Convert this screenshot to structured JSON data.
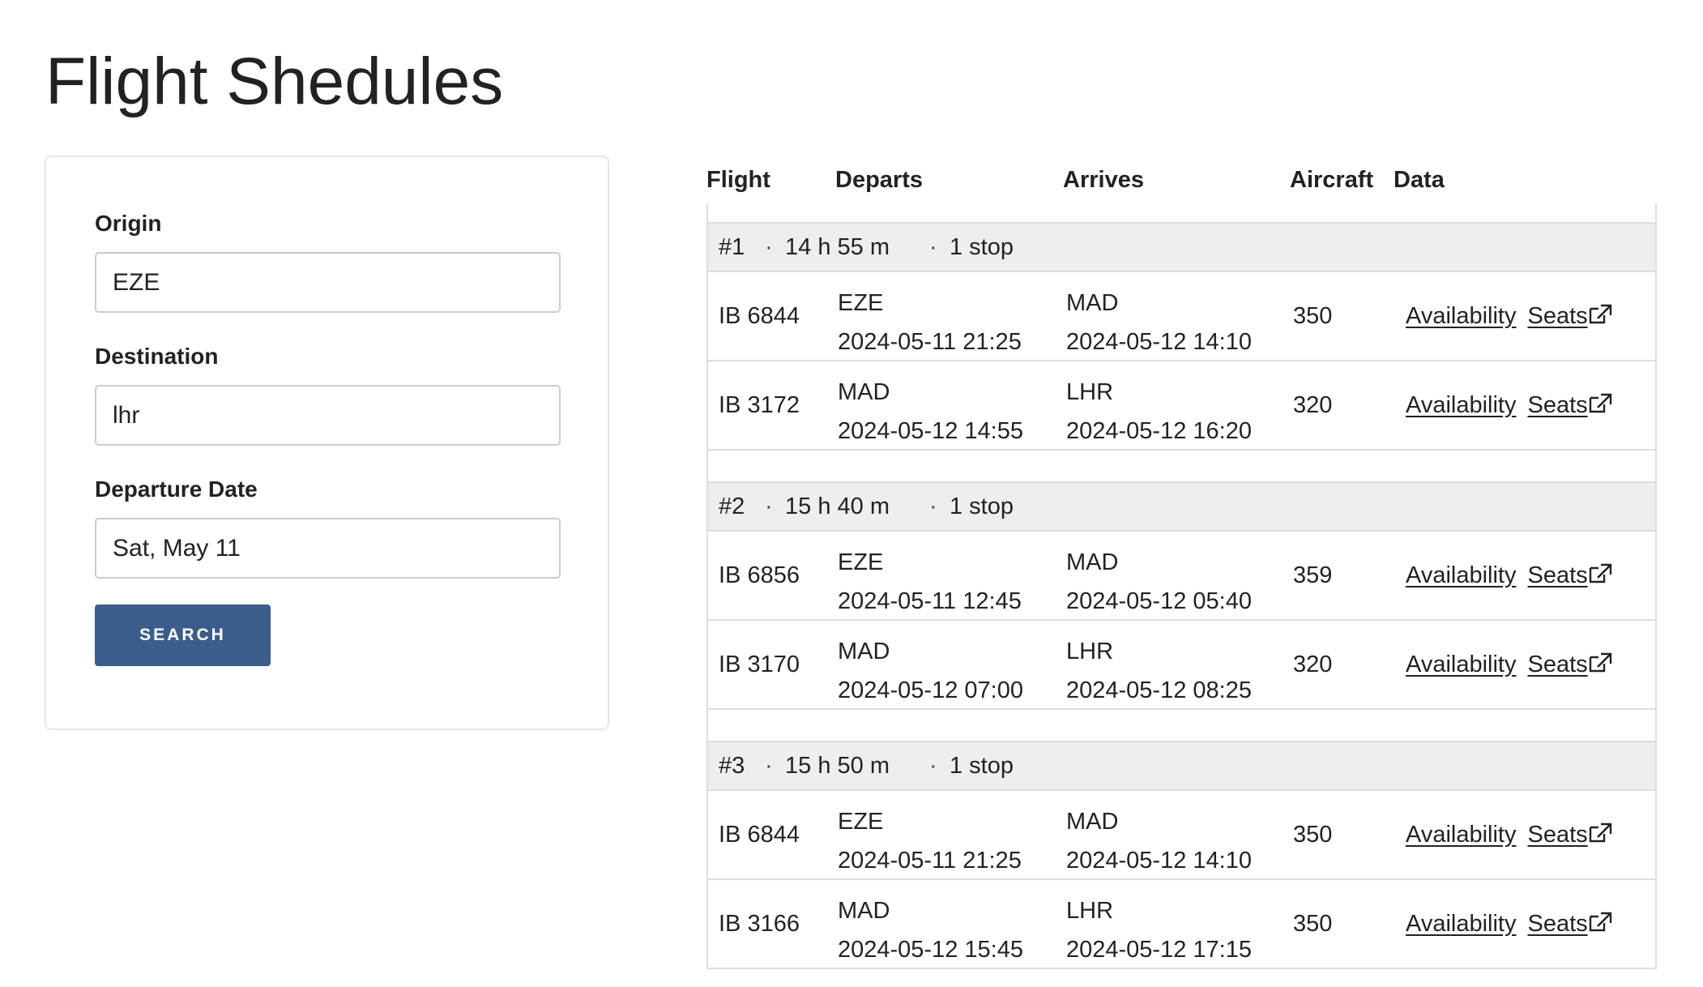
{
  "page_title": "Flight Shedules",
  "search": {
    "origin_label": "Origin",
    "origin_value": "EZE",
    "destination_label": "Destination",
    "destination_value": "lhr",
    "date_label": "Departure Date",
    "date_value": "Sat, May 11",
    "button_label": "SEARCH",
    "button_color": "#3a5d8c"
  },
  "table": {
    "headers": {
      "flight": "Flight",
      "departs": "Departs",
      "arrives": "Arrives",
      "aircraft": "Aircraft",
      "data": "Data"
    },
    "link_labels": {
      "availability": "Availability",
      "seats": "Seats"
    },
    "groups": [
      {
        "num": "#1",
        "duration": "14 h 55 m",
        "stops": "1 stop",
        "flights": [
          {
            "flight": "IB 6844",
            "dep_airport": "EZE",
            "dep_time": "2024-05-11 21:25",
            "arr_airport": "MAD",
            "arr_time": "2024-05-12 14:10",
            "aircraft": "350"
          },
          {
            "flight": "IB 3172",
            "dep_airport": "MAD",
            "dep_time": "2024-05-12 14:55",
            "arr_airport": "LHR",
            "arr_time": "2024-05-12 16:20",
            "aircraft": "320"
          }
        ]
      },
      {
        "num": "#2",
        "duration": "15 h 40 m",
        "stops": "1 stop",
        "flights": [
          {
            "flight": "IB 6856",
            "dep_airport": "EZE",
            "dep_time": "2024-05-11 12:45",
            "arr_airport": "MAD",
            "arr_time": "2024-05-12 05:40",
            "aircraft": "359"
          },
          {
            "flight": "IB 3170",
            "dep_airport": "MAD",
            "dep_time": "2024-05-12 07:00",
            "arr_airport": "LHR",
            "arr_time": "2024-05-12 08:25",
            "aircraft": "320"
          }
        ]
      },
      {
        "num": "#3",
        "duration": "15 h 50 m",
        "stops": "1 stop",
        "flights": [
          {
            "flight": "IB 6844",
            "dep_airport": "EZE",
            "dep_time": "2024-05-11 21:25",
            "arr_airport": "MAD",
            "arr_time": "2024-05-12 14:10",
            "aircraft": "350"
          },
          {
            "flight": "IB 3166",
            "dep_airport": "MAD",
            "dep_time": "2024-05-12 15:45",
            "arr_airport": "LHR",
            "arr_time": "2024-05-12 17:15",
            "aircraft": "350"
          }
        ]
      }
    ]
  }
}
